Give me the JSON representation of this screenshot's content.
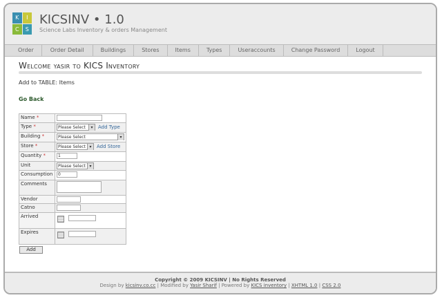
{
  "header": {
    "title": "KICSINV • 1.0",
    "subtitle": "Science Labs Inventory & orders Management",
    "logo": [
      "K",
      "I",
      "C",
      "S"
    ]
  },
  "nav": [
    "Order",
    "Order Detail",
    "Buildings",
    "Stores",
    "Items",
    "Types",
    "Useraccounts",
    "Change Password",
    "Logout"
  ],
  "welcome": "Welcome yasir to KICS Inventory",
  "add_to": "Add to TABLE: Items",
  "go_back": "Go Back",
  "form": {
    "name": "Name",
    "type": "Type",
    "building": "Building",
    "store": "Store",
    "quantity": "Quantity",
    "unit": "Unit",
    "consumption": "Consumption",
    "comments": "Comments",
    "vendor": "Vendor",
    "catno": "Catno",
    "arrived": "Arrived",
    "expires": "Expires",
    "required": "*",
    "please_select": "Please Select",
    "add_type": "Add Type",
    "add_store": "Add Store",
    "quantity_value": "1",
    "consumption_value": "0",
    "add_button": "Add"
  },
  "footer": {
    "copyright": "Copyright © 2009 KICSINV | No Rights Reserved",
    "design_by": "Design by",
    "design_link": "kicsinv.co.cc",
    "modified_by": "| Modified by",
    "modified_link": "Yasir Sharif",
    "powered_by": "| Powered by",
    "powered_link": "KICS inventory",
    "xhtml": "XHTML 1.0",
    "css": "CSS 2.0",
    "sep": "|"
  }
}
